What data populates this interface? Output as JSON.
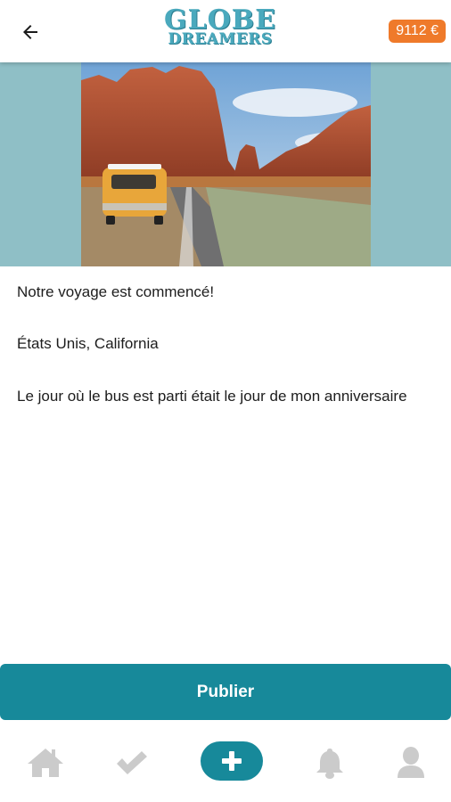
{
  "header": {
    "logo_line1": "GLOBE",
    "logo_line2": "DREAMERS",
    "balance": "9112 €"
  },
  "post": {
    "title": "Notre voyage est commencé!",
    "location": "États Unis, California",
    "description": "Le jour où le bus est parti était le jour de mon anniversaire"
  },
  "actions": {
    "publish_label": "Publier"
  },
  "colors": {
    "accent": "#17899a",
    "balance_badge": "#ef7a2a",
    "logo": "#4aa9bd"
  },
  "nav": {
    "icons": [
      "home-icon",
      "check-icon",
      "plus-icon",
      "bell-icon",
      "user-icon"
    ]
  }
}
